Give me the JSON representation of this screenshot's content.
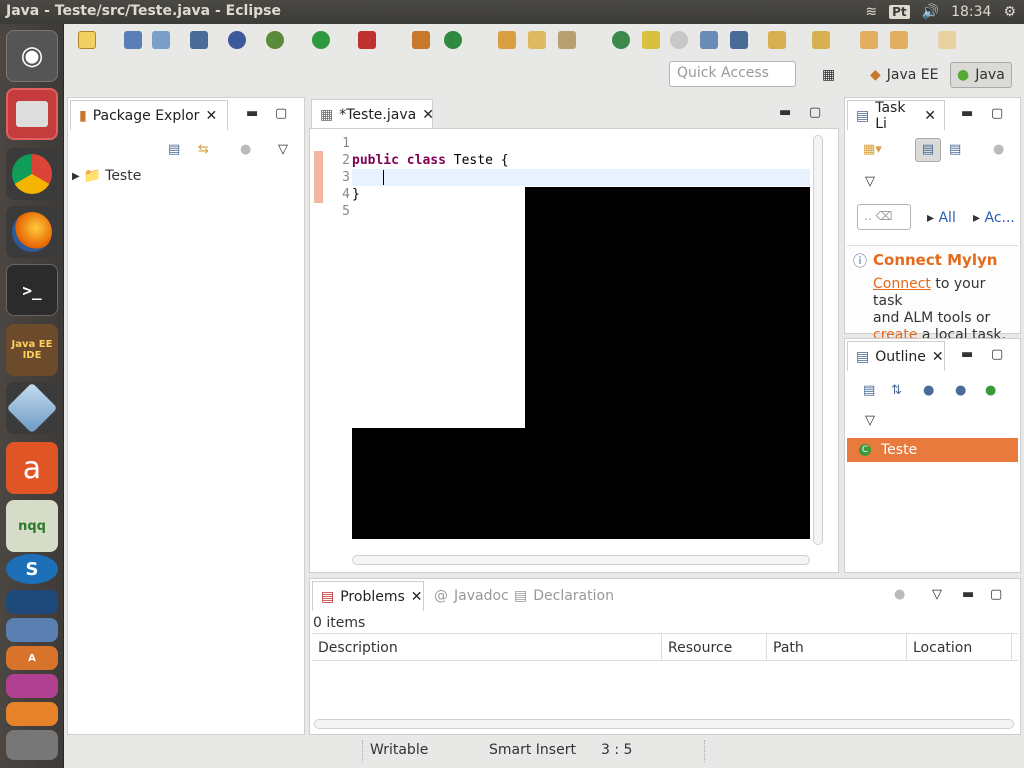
{
  "window": {
    "title": "Java - Teste/src/Teste.java - Eclipse"
  },
  "tray": {
    "lang": "Pt",
    "time": "18:34"
  },
  "launcher": {
    "items": [
      {
        "name": "dash-icon",
        "label": ""
      },
      {
        "name": "files-icon",
        "label": ""
      },
      {
        "name": "chrome-icon",
        "label": ""
      },
      {
        "name": "firefox-icon",
        "label": ""
      },
      {
        "name": "terminal-icon",
        "label": ""
      },
      {
        "name": "eclipse-javaee-icon",
        "label": "Java EE IDE"
      },
      {
        "name": "virtualbox-icon",
        "label": ""
      },
      {
        "name": "software-center-icon",
        "label": "a"
      },
      {
        "name": "notes-icon",
        "label": "nqq"
      }
    ]
  },
  "quick_access": {
    "placeholder": "Quick Access"
  },
  "perspectives": {
    "javaee": "Java EE",
    "java": "Java"
  },
  "package_explorer": {
    "tab": "Package Explor",
    "project": "Teste"
  },
  "editor": {
    "tab": "*Teste.java",
    "line_numbers": [
      "1",
      "2",
      "3",
      "4",
      "5"
    ],
    "line2": {
      "kw1": "public",
      "kw2": "class",
      "rest": " Teste {"
    },
    "line4": "}"
  },
  "task_list": {
    "tab": "Task Li",
    "filter_placeholder": "..",
    "all": "All",
    "activate": "Ac...",
    "mylyn_title": "Connect Mylyn",
    "connect": "Connect",
    "msg1": " to your task",
    "msg2": "and ALM tools or",
    "create": "create",
    "msg3": " a local task."
  },
  "outline": {
    "tab": "Outline",
    "item": "Teste"
  },
  "bottom": {
    "tabs": {
      "problems": "Problems",
      "javadoc": "Javadoc",
      "declaration": "Declaration"
    },
    "count": "0 items",
    "columns": [
      "Description",
      "Resource",
      "Path",
      "Location"
    ]
  },
  "status": {
    "writable": "Writable",
    "insert": "Smart Insert",
    "position": "3 : 5"
  }
}
